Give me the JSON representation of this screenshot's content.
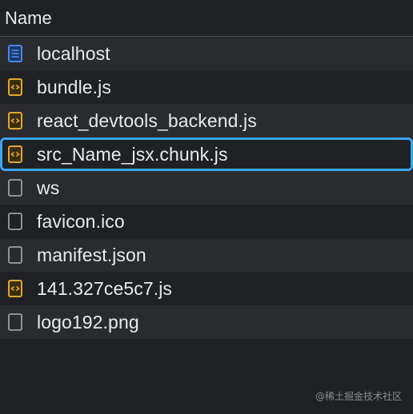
{
  "header": {
    "title": "Name"
  },
  "rows": [
    {
      "label": "localhost",
      "icon": "document-icon"
    },
    {
      "label": "bundle.js",
      "icon": "script-icon"
    },
    {
      "label": "react_devtools_backend.js",
      "icon": "script-icon"
    },
    {
      "label": "src_Name_jsx.chunk.js",
      "icon": "script-icon",
      "selected": true
    },
    {
      "label": "ws",
      "icon": "blank-file-icon"
    },
    {
      "label": "favicon.ico",
      "icon": "blank-file-icon"
    },
    {
      "label": "manifest.json",
      "icon": "blank-file-icon"
    },
    {
      "label": "141.327ce5c7.js",
      "icon": "script-icon"
    },
    {
      "label": "logo192.png",
      "icon": "blank-file-icon"
    }
  ],
  "watermark": "@稀土掘金技术社区",
  "colors": {
    "background": "#202124",
    "row_alt": "#2a2b2e",
    "text": "#e8eaed",
    "selection_border": "#3aa6f0",
    "script_icon": "#e0a530",
    "document_icon": "#4a86e8",
    "blank_icon": "#9aa0a6"
  }
}
